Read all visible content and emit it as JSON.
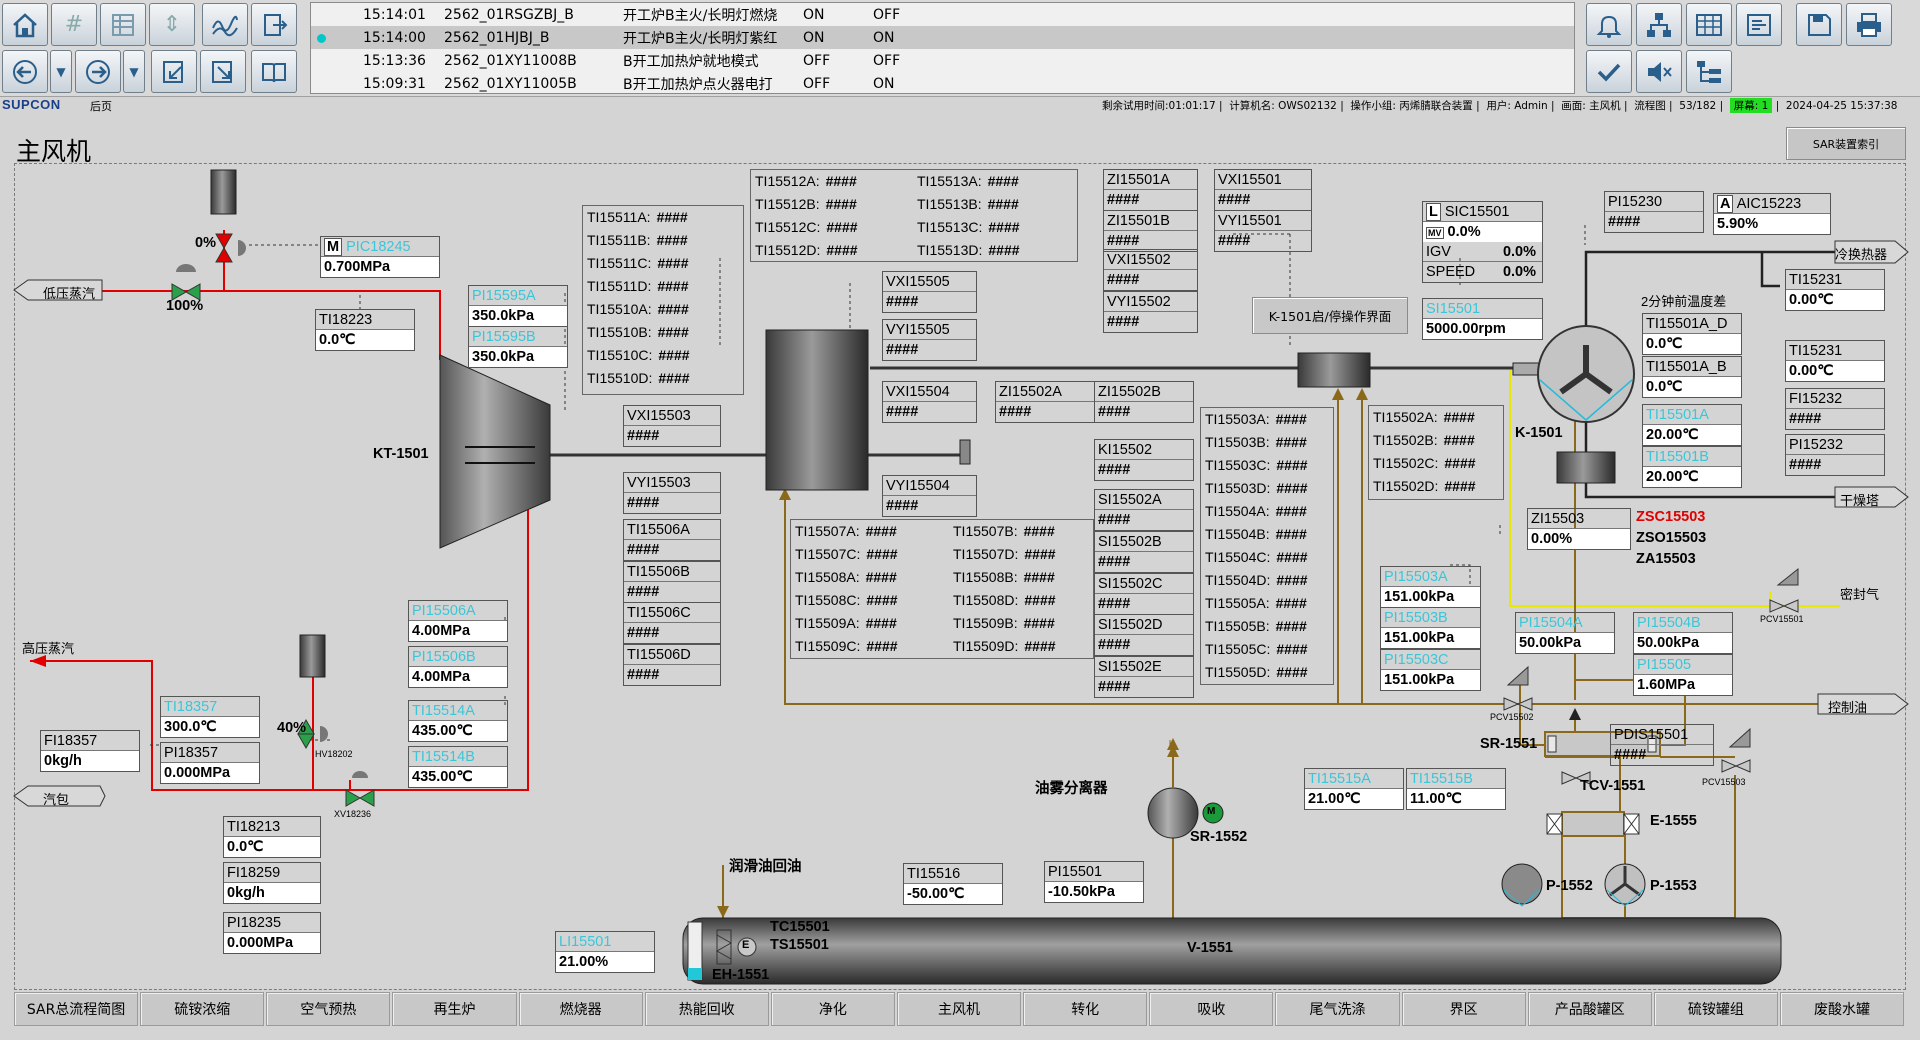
{
  "toolbar": {
    "left_row1": [
      "home-icon",
      "grid-hash-icon",
      "table-icon",
      "updown-icon",
      "trend-icon",
      "export-doc-icon"
    ],
    "left_row2": [
      "back-circle-icon",
      "dropdown-icon",
      "forward-circle-icon",
      "dropdown-icon",
      "import-icon",
      "export-icon",
      "book-icon"
    ],
    "right_row1": [
      "alarm-bell-icon",
      "network-icon",
      "spreadsheet-icon",
      "report-icon",
      "save-icon",
      "print-icon"
    ],
    "right_row2": [
      "confirm-check-icon",
      "mute-speaker-icon",
      "tree-icon"
    ]
  },
  "alarms": [
    {
      "time": "15:14:01",
      "tag": "2562_01RSGZBJ_B",
      "desc": "开工炉B主火/长明灯燃烧",
      "v1": "ON",
      "v2": "OFF",
      "selected": false
    },
    {
      "time": "15:14:00",
      "tag": "2562_01HJBJ_B",
      "desc": "开工炉B主火/长明灯紫红",
      "v1": "ON",
      "v2": "ON",
      "selected": true
    },
    {
      "time": "15:13:36",
      "tag": "2562_01XY11008B",
      "desc": "B开工加热炉就地模式",
      "v1": "OFF",
      "v2": "OFF",
      "selected": false
    },
    {
      "time": "15:09:31",
      "tag": "2562_01XY11005B",
      "desc": "B开工加热炉点火器电打",
      "v1": "OFF",
      "v2": "ON",
      "selected": false
    }
  ],
  "status": {
    "brand": "SUPCON",
    "back": "后页",
    "trial": "剩余试用时间:01:01:17",
    "computer": "计算机名: OWS02132",
    "group": "操作小组: 丙烯腈联合装置",
    "user": "用户: Admin",
    "screen": "画面: 主风机",
    "flow": "流程图",
    "page": "53/182",
    "screen_no": "屏幕: 1",
    "datetime": "2024-04-25 15:37:38"
  },
  "page_title": "主风机",
  "sar_index": "SAR装置索引",
  "k1501_button": "K-1501启/停操作界面",
  "labels": {
    "low_steam": "低压蒸汽",
    "high_steam": "高压蒸汽",
    "drum": "汽包",
    "cold_exch": "冷换热器",
    "dryer": "干燥塔",
    "seal_gas": "密封气",
    "ctrl_oil": "控制油",
    "kt1501": "KT-1501",
    "k1501": "K-1501",
    "oil_sep": "油雾分离器",
    "sr1552": "SR-1552",
    "lube_return": "润滑油回油",
    "v1551": "V-1551",
    "eh1551": "EH-1551",
    "tc15501": "TC15501",
    "ts15501": "TS15501",
    "sr1551": "SR-1551",
    "tcv1551": "TCV-1551",
    "e1555": "E-1555",
    "p1552": "P-1552",
    "p1553": "P-1553",
    "zsc": "ZSC15503",
    "zso": "ZSO15503",
    "za": "ZA15503",
    "temp_diff": "2分钟前温度差",
    "hv18202": "HV18202",
    "xv18236": "XV18236",
    "pcv15501": "PCV15501",
    "pcv15502": "PCV15502",
    "pcv15503": "PCV15503",
    "v_top": "0%",
    "v_bot": "100%",
    "v_hv": "40%",
    "motor": "M",
    "e_mark": "E"
  },
  "boxes": {
    "pic18245": {
      "tag": "PIC18245",
      "val": "0.700MPa",
      "mode": "M"
    },
    "ti18223": {
      "tag": "TI18223",
      "val": "0.0℃"
    },
    "pi15595a": {
      "tag": "PI15595A",
      "val": "350.0kPa"
    },
    "pi15595b": {
      "tag": "PI15595B",
      "val": "350.0kPa"
    },
    "pi15506a": {
      "tag": "PI15506A",
      "val": "4.00MPa"
    },
    "pi15506b": {
      "tag": "PI15506B",
      "val": "4.00MPa"
    },
    "ti15514a": {
      "tag": "TI15514A",
      "val": "435.00℃"
    },
    "ti15514b": {
      "tag": "TI15514B",
      "val": "435.00℃"
    },
    "ti18357": {
      "tag": "TI18357",
      "val": "300.0℃"
    },
    "pi18357": {
      "tag": "PI18357",
      "val": "0.000MPa"
    },
    "fi18357": {
      "tag": "FI18357",
      "val": "0kg/h"
    },
    "ti18213": {
      "tag": "TI18213",
      "val": "0.0℃"
    },
    "fi18259": {
      "tag": "FI18259",
      "val": "0kg/h"
    },
    "pi18235": {
      "tag": "PI18235",
      "val": "0.000MPa"
    },
    "vxi15503": {
      "tag": "VXI15503",
      "val": "####"
    },
    "vyi15503": {
      "tag": "VYI15503",
      "val": "####"
    },
    "ti15506a": {
      "tag": "TI15506A",
      "val": "####"
    },
    "ti15506b": {
      "tag": "TI15506B",
      "val": "####"
    },
    "ti15506c": {
      "tag": "TI15506C",
      "val": "####"
    },
    "ti15506d": {
      "tag": "TI15506D",
      "val": "####"
    },
    "vxi15505": {
      "tag": "VXI15505",
      "val": "####"
    },
    "vyi15505": {
      "tag": "VYI15505",
      "val": "####"
    },
    "vxi15504": {
      "tag": "VXI15504",
      "val": "####"
    },
    "vyi15504": {
      "tag": "VYI15504",
      "val": "####"
    },
    "zi15502a": {
      "tag": "ZI15502A",
      "val": "####"
    },
    "zi15502b": {
      "tag": "ZI15502B",
      "val": "####"
    },
    "ki15502": {
      "tag": "KI15502",
      "val": "####"
    },
    "si15502a": {
      "tag": "SI15502A",
      "val": "####"
    },
    "si15502b": {
      "tag": "SI15502B",
      "val": "####"
    },
    "si15502c": {
      "tag": "SI15502C",
      "val": "####"
    },
    "si15502d": {
      "tag": "SI15502D",
      "val": "####"
    },
    "si15502e": {
      "tag": "SI15502E",
      "val": "####"
    },
    "zi15501a": {
      "tag": "ZI15501A",
      "val": "####"
    },
    "zi15501b": {
      "tag": "ZI15501B",
      "val": "####"
    },
    "vxi15502": {
      "tag": "VXI15502",
      "val": "####"
    },
    "vyi15502": {
      "tag": "VYI15502",
      "val": "####"
    },
    "vxi15501": {
      "tag": "VXI15501",
      "val": "####"
    },
    "vyi15501": {
      "tag": "VYI15501",
      "val": "####"
    },
    "si15501": {
      "tag": "SI15501",
      "val": "5000.00rpm"
    },
    "pi15230": {
      "tag": "PI15230",
      "val": "####"
    },
    "aic15223": {
      "tag": "AIC15223",
      "val": "5.90%",
      "mode": "A"
    },
    "ti15231a": {
      "tag": "TI15231",
      "val": "0.00℃"
    },
    "ti15231b": {
      "tag": "TI15231",
      "val": "0.00℃"
    },
    "fi15232": {
      "tag": "FI15232",
      "val": "####"
    },
    "pi15232": {
      "tag": "PI15232",
      "val": "####"
    },
    "ti15501a_d": {
      "tag": "TI15501A_D",
      "val": "0.0℃"
    },
    "ti15501a_b": {
      "tag": "TI15501A_B",
      "val": "0.0℃"
    },
    "ti15501a": {
      "tag": "TI15501A",
      "val": "20.00℃"
    },
    "ti15501b": {
      "tag": "TI15501B",
      "val": "20.00℃"
    },
    "zi15503": {
      "tag": "ZI15503",
      "val": "0.00%"
    },
    "pi15503a": {
      "tag": "PI15503A",
      "val": "151.00kPa"
    },
    "pi15503b": {
      "tag": "PI15503B",
      "val": "151.00kPa"
    },
    "pi15503c": {
      "tag": "PI15503C",
      "val": "151.00kPa"
    },
    "pi15504a": {
      "tag": "PI15504A",
      "val": "50.00kPa"
    },
    "pi15504b": {
      "tag": "PI15504B",
      "val": "50.00kPa"
    },
    "pi15505": {
      "tag": "PI15505",
      "val": "1.60MPa"
    },
    "pdis15501": {
      "tag": "PDIS15501",
      "val": "####"
    },
    "ti15515a": {
      "tag": "TI15515A",
      "val": "21.00℃"
    },
    "ti15515b": {
      "tag": "TI15515B",
      "val": "11.00℃"
    },
    "ti15516": {
      "tag": "TI15516",
      "val": "-50.00℃"
    },
    "pi15501": {
      "tag": "PI15501",
      "val": "-10.50kPa"
    },
    "li15501": {
      "tag": "LI15501",
      "val": "21.00%"
    }
  },
  "sic15501": {
    "tag": "SIC15501",
    "mode": "L",
    "mv": "0.0%",
    "mv_label": "MV",
    "igv_label": "IGV",
    "igv": "0.0%",
    "speed_label": "SPEED",
    "speed": "0.0%"
  },
  "list_ti15510": [
    "TI15511A:",
    "TI15511B:",
    "TI15511C:",
    "TI15511D:",
    "TI15510A:",
    "TI15510B:",
    "TI15510C:",
    "TI15510D:"
  ],
  "list_ti15512": [
    "TI15512A:",
    "TI15512B:",
    "TI15512C:",
    "TI15512D:"
  ],
  "list_ti15513": [
    "TI15513A:",
    "TI15513B:",
    "TI15513C:",
    "TI15513D:"
  ],
  "list_ti15507_l": [
    "TI15507A:",
    "TI15507C:",
    "TI15508A:",
    "TI15508C:",
    "TI15509A:",
    "TI15509C:"
  ],
  "list_ti15507_r": [
    "TI15507B:",
    "TI15507D:",
    "TI15508B:",
    "TI15508D:",
    "TI15509B:",
    "TI15509D:"
  ],
  "list_ti15503": [
    "TI15503A:",
    "TI15503B:",
    "TI15503C:",
    "TI15503D:",
    "TI15504A:",
    "TI15504B:",
    "TI15504C:",
    "TI15504D:",
    "TI15505A:",
    "TI15505B:",
    "TI15505C:",
    "TI15505D:"
  ],
  "list_ti15502": [
    "TI15502A:",
    "TI15502B:",
    "TI15502C:",
    "TI15502D:"
  ],
  "hash": "####",
  "nav": [
    "SAR总流程简图",
    "硫铵浓缩",
    "空气预热",
    "再生炉",
    "燃烧器",
    "热能回收",
    "净化",
    "主风机",
    "转化",
    "吸收",
    "尾气洗涤",
    "界区",
    "产品酸罐区",
    "硫铵罐组",
    "废酸水罐"
  ],
  "colors": {
    "steam": "#e00000",
    "oil": "#8a6a1a",
    "seal": "#e8e800",
    "air": "#222222",
    "tag_cyan": "#3bc6d8"
  }
}
